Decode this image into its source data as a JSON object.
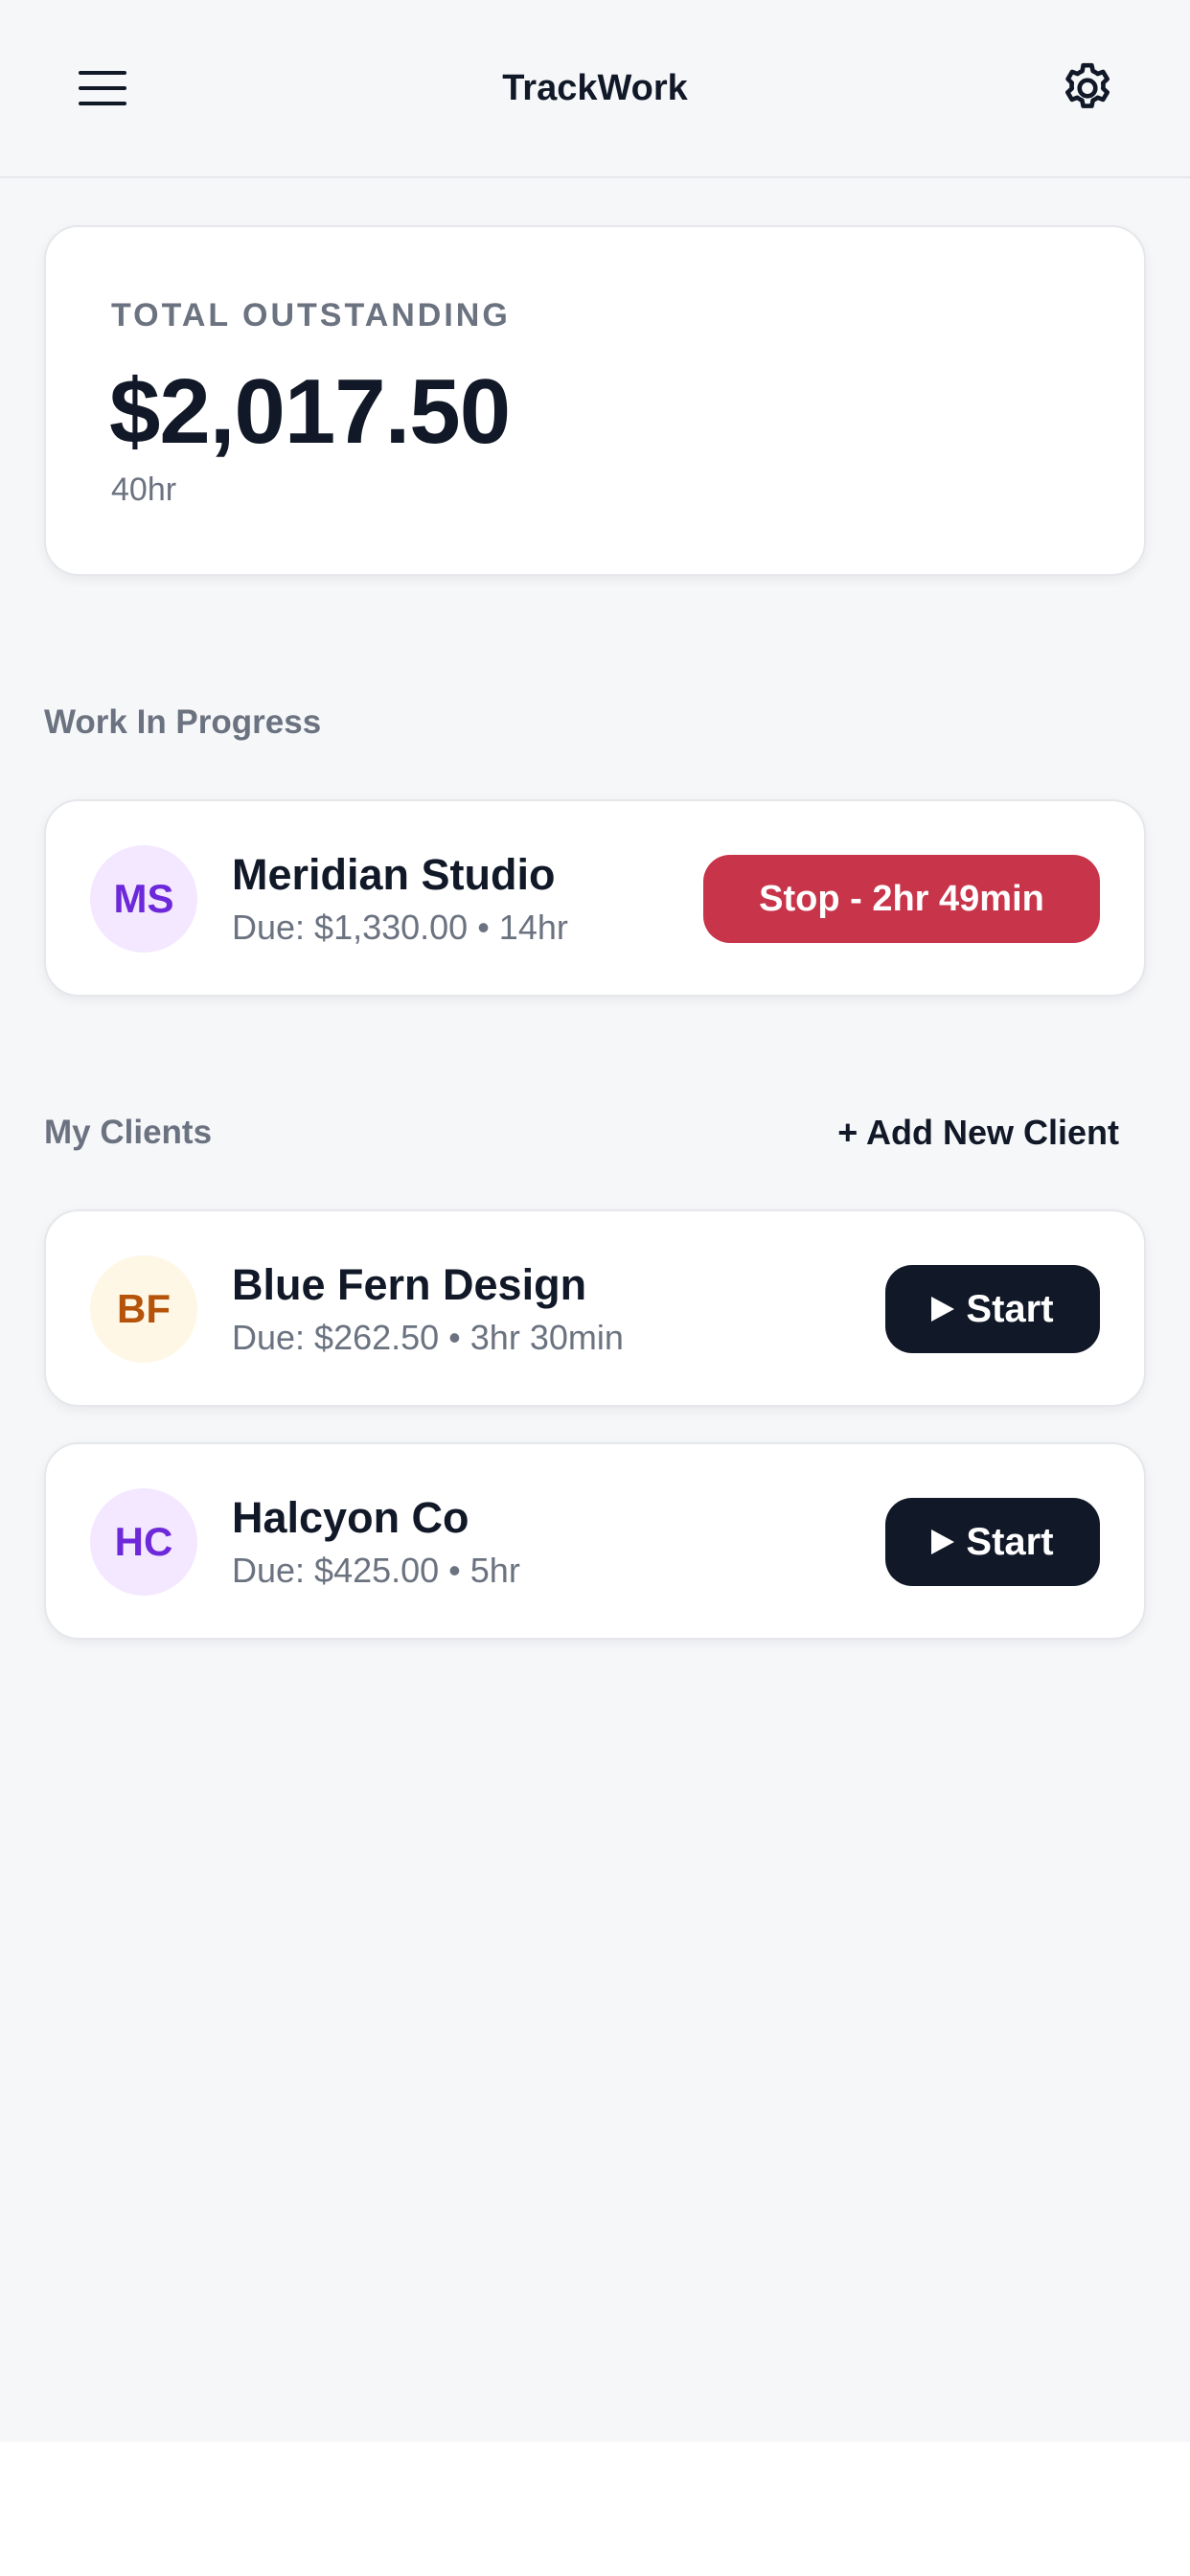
{
  "header": {
    "title": "TrackWork",
    "menu_icon": "menu-icon",
    "settings_icon": "gear-icon"
  },
  "summary": {
    "label": "TOTAL OUTSTANDING",
    "amount": "$2,017.50",
    "hours": "40hr"
  },
  "work_in_progress": {
    "title": "Work In Progress",
    "client": {
      "initials": "MS",
      "name": "Meridian Studio",
      "meta": "Due: $1,330.00 • 14hr",
      "action_label": "Stop - 2hr 49min",
      "avatar_bg": "#f3e8ff",
      "avatar_text": "#6d28d9",
      "action_color": "#c8344a"
    }
  },
  "my_clients": {
    "title": "My Clients",
    "add_label": "+ Add New Client",
    "items": [
      {
        "initials": "BF",
        "name": "Blue Fern Design",
        "meta": "Due: $262.50 • 3hr 30min",
        "action_label": "Start",
        "avatar_bg": "#fff7e6",
        "avatar_text": "#b45309"
      },
      {
        "initials": "HC",
        "name": "Halcyon Co",
        "meta": "Due: $425.00 • 5hr",
        "action_label": "Start",
        "avatar_bg": "#f3e8ff",
        "avatar_text": "#6d28d9"
      }
    ]
  },
  "colors": {
    "background": "#f6f7f9",
    "card": "#ffffff",
    "primary": "#111827",
    "muted": "#6b7280",
    "stop": "#c8344a"
  }
}
